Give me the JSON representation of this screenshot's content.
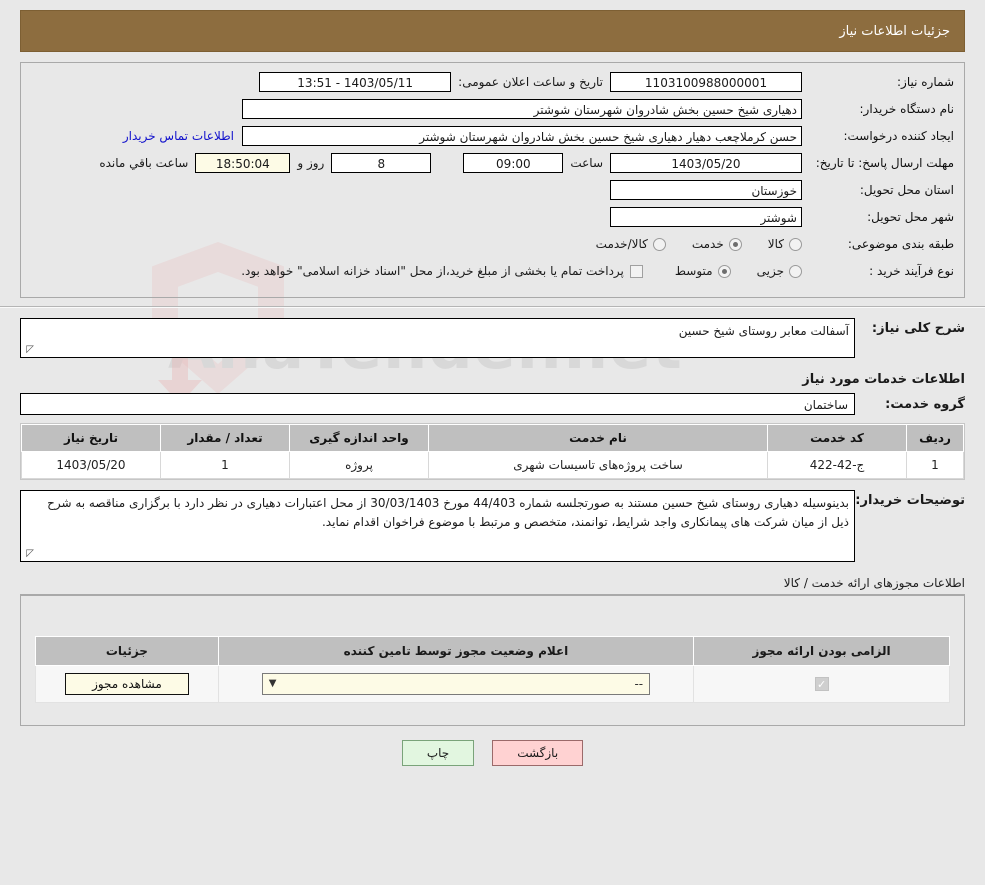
{
  "header": {
    "title": "جزئیات اطلاعات نیاز"
  },
  "form": {
    "need_number_label": "شماره نیاز:",
    "need_number_value": "1103100988000001",
    "announce_label": "تاریخ و ساعت اعلان عمومی:",
    "announce_value": "1403/05/11 - 13:51",
    "buyer_org_label": "نام دستگاه خریدار:",
    "buyer_org_value": "دهیاری شیخ حسین بخش شادروان شهرستان شوشتر",
    "creator_label": "ایجاد کننده درخواست:",
    "creator_value": "حسن کرملاچعب دهیار دهیاری شیخ حسین بخش شادروان شهرستان شوشتر",
    "contact_link": "اطلاعات تماس خریدار",
    "deadline_label": "مهلت ارسال پاسخ: تا تاریخ:",
    "deadline_date": "1403/05/20",
    "hour_label": "ساعت",
    "deadline_time": "09:00",
    "days_value": "8",
    "days_label": "روز و",
    "clock_value": "18:50:04",
    "remaining_label": "ساعت باقي مانده",
    "province_label": "استان محل تحویل:",
    "province_value": "خوزستان",
    "city_label": "شهر محل تحویل:",
    "city_value": "شوشتر",
    "category_label": "طبقه بندی موضوعی:",
    "category_options": [
      {
        "label": "کالا",
        "selected": false
      },
      {
        "label": "خدمت",
        "selected": true
      },
      {
        "label": "کالا/خدمت",
        "selected": false
      }
    ],
    "process_label": "نوع فرآیند خرید :",
    "process_options": [
      {
        "label": "جزیی",
        "selected": false
      },
      {
        "label": "متوسط",
        "selected": true
      }
    ],
    "treasury_checkbox_label": "پرداخت تمام یا بخشی از مبلغ خرید،از محل \"اسناد خزانه اسلامی\" خواهد بود."
  },
  "summary": {
    "label": "شرح کلی نیاز:",
    "value": "آسفالت معابر روستای شیخ حسین"
  },
  "services": {
    "section_title": "اطلاعات خدمات مورد نیاز",
    "group_label": "گروه خدمت:",
    "group_value": "ساختمان",
    "columns": [
      "ردیف",
      "کد خدمت",
      "نام خدمت",
      "واحد اندازه گیری",
      "تعداد / مقدار",
      "تاریخ نیاز"
    ],
    "rows": [
      {
        "index": "1",
        "code": "ج-42-422",
        "name": "ساخت پروژه‌های تاسیسات شهری",
        "unit": "پروژه",
        "quantity": "1",
        "need_date": "1403/05/20"
      }
    ]
  },
  "notes": {
    "label": "توضیحات خریدار:",
    "value": "بدینوسیله دهیاری روستای شیخ حسین مستند به صورتجلسه شماره 44/403  مورخ 30/03/1403 از محل اعتبارات دهیاری در نظر دارد با برگزاری مناقصه به شرح ذیل از میان شرکت های پیمانکاری واجد شرایط، توانمند، متخصص و مرتبط با موضوع فراخوان اقدام نماید."
  },
  "licenses": {
    "title": "اطلاعات مجوزهای ارائه خدمت / کالا",
    "columns": [
      "الزامی بودن ارائه مجوز",
      "اعلام وضعیت مجوز توسط تامین کننده",
      "جزئیات"
    ],
    "rows": [
      {
        "required": "✓",
        "status_value": "--",
        "detail_button": "مشاهده مجوز"
      }
    ]
  },
  "footer": {
    "back_label": "بازگشت",
    "print_label": "چاپ"
  }
}
